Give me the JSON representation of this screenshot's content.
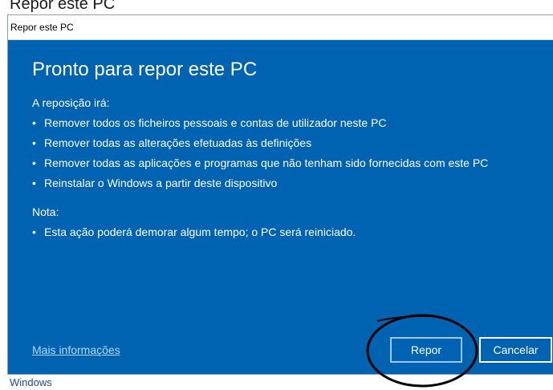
{
  "background": {
    "title": "Repor este PC",
    "footer_text": "Windows"
  },
  "dialog": {
    "title": "Repor este PC",
    "heading": "Pronto para repor este PC",
    "intro": "A reposição irá:",
    "items": [
      "Remover todos os ficheiros pessoais e contas de utilizador neste PC",
      "Remover todas as alterações efetuadas às definições",
      "Remover todas as aplicações e programas que não tenham sido fornecidas com este PC",
      "Reinstalar o Windows a partir deste dispositivo"
    ],
    "note_label": "Nota:",
    "note_items": [
      "Esta ação poderá demorar algum tempo; o PC será reiniciado."
    ],
    "more_info_link": "Mais informações",
    "reset_button": "Repor",
    "cancel_button": "Cancelar",
    "bullet_char": "•"
  },
  "colors": {
    "dialog_background": "#0063b1",
    "annotation_circle": "#000000"
  }
}
